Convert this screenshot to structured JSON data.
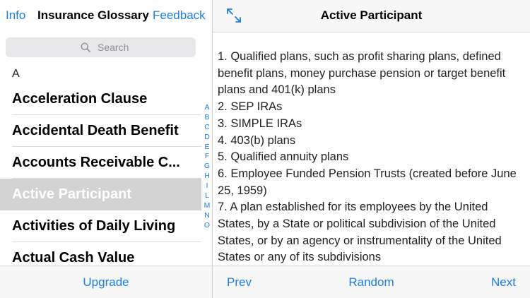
{
  "left": {
    "nav": {
      "info_label": "Info",
      "title": "Insurance Glossary",
      "feedback_label": "Feedback"
    },
    "search": {
      "placeholder": "Search",
      "icon": "search-icon"
    },
    "section_letter": "A",
    "items": [
      {
        "label": "Acceleration Clause",
        "selected": false
      },
      {
        "label": "Accidental Death Benefit",
        "selected": false
      },
      {
        "label": "Accounts Receivable C...",
        "selected": false
      },
      {
        "label": "Active Participant",
        "selected": true
      },
      {
        "label": "Activities of Daily Living",
        "selected": false
      },
      {
        "label": "Actual Cash Value",
        "selected": false
      }
    ],
    "index_letters": [
      "A",
      "B",
      "C",
      "D",
      "E",
      "F",
      "G",
      "H",
      "I",
      "L",
      "M",
      "N",
      "O"
    ],
    "bottom": {
      "upgrade_label": "Upgrade"
    }
  },
  "right": {
    "nav": {
      "expand_icon": "expand-icon",
      "title": "Active Participant"
    },
    "content": [
      "1. Qualified plans, such as profit sharing plans, defined benefit plans, money purchase pension or target benefit plans and 401(k) plans",
      "2. SEP IRAs",
      "3. SIMPLE IRAs",
      "4. 403(b) plans",
      "5. Qualified annuity plans",
      "6. Employee Funded Pension Trusts (created before June 25, 1959)",
      "7. A plan established for its employees by the United States, by a State or political subdivision of the United States, or by an agency or instrumentality of the United States or any of its subdivisions"
    ],
    "bottom": {
      "prev_label": "Prev",
      "random_label": "Random",
      "next_label": "Next"
    }
  },
  "colors": {
    "accent": "#1a7ee8",
    "selected_row": "#d3d3d3",
    "bar_background": "#f7f7f7"
  }
}
